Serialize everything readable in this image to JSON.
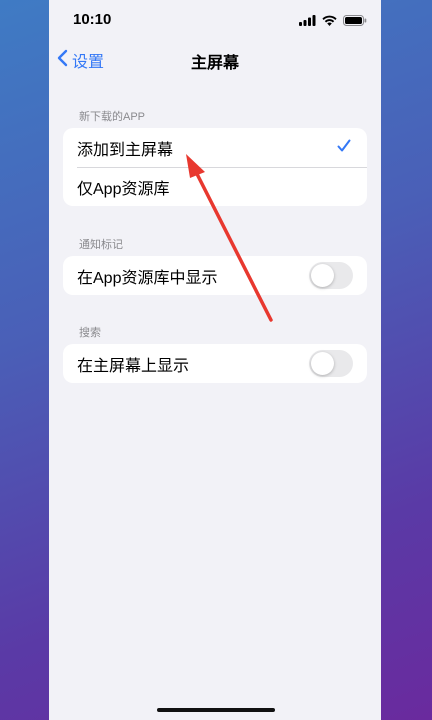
{
  "status_bar": {
    "time": "10:10"
  },
  "nav": {
    "back_label": "设置",
    "title": "主屏幕"
  },
  "sections": [
    {
      "header": "新下载的APP",
      "rows": [
        {
          "label": "添加到主屏幕",
          "selected": true
        },
        {
          "label": "仅App资源库",
          "selected": false
        }
      ]
    },
    {
      "header": "通知标记",
      "rows": [
        {
          "label": "在App资源库中显示",
          "toggle": false
        }
      ]
    },
    {
      "header": "搜索",
      "rows": [
        {
          "label": "在主屏幕上显示",
          "toggle": false
        }
      ]
    }
  ],
  "colors": {
    "accent": "#3478f6",
    "annotation_arrow": "#e8382f",
    "background": "#f2f2f7"
  },
  "icons": [
    "signal-icon",
    "wifi-icon",
    "battery-icon",
    "chevron-left-icon",
    "checkmark-icon",
    "arrow-annotation"
  ]
}
